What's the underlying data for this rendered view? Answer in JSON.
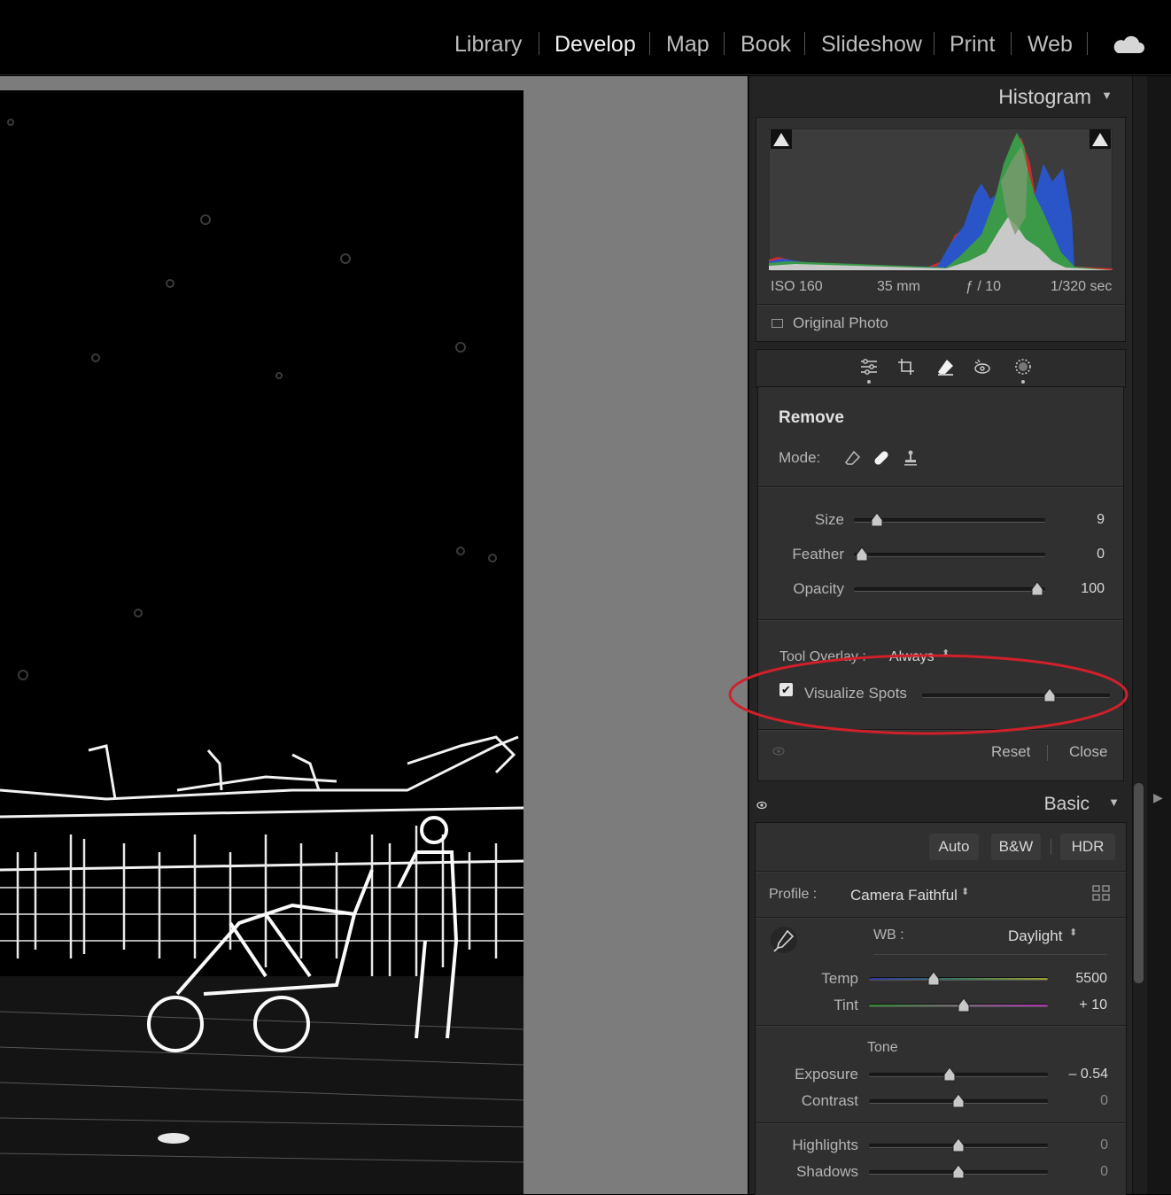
{
  "modules": {
    "items": [
      "Library",
      "Develop",
      "Map",
      "Book",
      "Slideshow",
      "Print",
      "Web"
    ],
    "active": "Develop"
  },
  "histogram": {
    "title": "Histogram",
    "iso": "ISO 160",
    "focal": "35 mm",
    "aperture": "ƒ / 10",
    "shutter": "1/320 sec",
    "original_photo_label": "Original Photo"
  },
  "remove": {
    "title": "Remove",
    "mode_label": "Mode:",
    "size_label": "Size",
    "size_value": "9",
    "size_fraction": 0.12,
    "feather_label": "Feather",
    "feather_value": "0",
    "feather_fraction": 0.04,
    "opacity_label": "Opacity",
    "opacity_value": "100",
    "opacity_fraction": 0.96,
    "tool_overlay_label": "Tool Overlay :",
    "tool_overlay_value": "Always",
    "visualize_label": "Visualize Spots",
    "visualize_checked": true,
    "visualize_fraction": 0.68,
    "reset_label": "Reset",
    "close_label": "Close"
  },
  "basic": {
    "title": "Basic",
    "auto_label": "Auto",
    "bw_label": "B&W",
    "hdr_label": "HDR",
    "profile_label": "Profile :",
    "profile_value": "Camera Faithful",
    "wb_label": "WB :",
    "wb_value": "Daylight",
    "temp_label": "Temp",
    "temp_value": "5500",
    "temp_fraction": 0.36,
    "tint_label": "Tint",
    "tint_value": "+ 10",
    "tint_fraction": 0.53,
    "tone_label": "Tone",
    "exposure_label": "Exposure",
    "exposure_value": "– 0.54",
    "exposure_fraction": 0.45,
    "contrast_label": "Contrast",
    "contrast_value": "0",
    "contrast_fraction": 0.5,
    "highlights_label": "Highlights",
    "highlights_value": "0",
    "highlights_fraction": 0.5,
    "shadows_label": "Shadows",
    "shadows_value": "0",
    "shadows_fraction": 0.5
  },
  "colors": {
    "annotation": "#d0202a",
    "panel_bg": "#242424",
    "canvas_bg": "#7c7c7c"
  }
}
